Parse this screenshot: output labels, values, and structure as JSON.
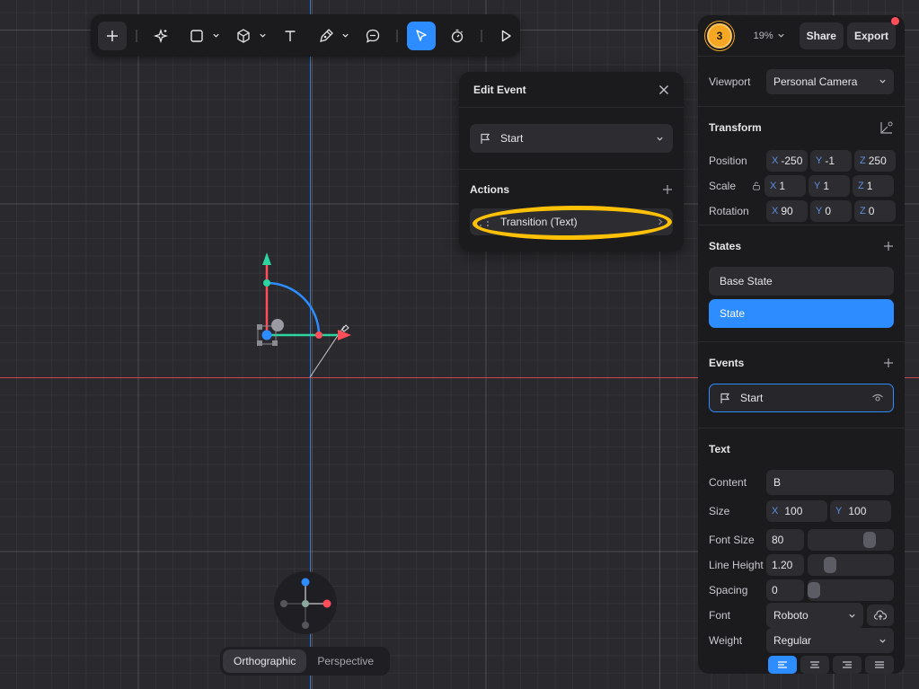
{
  "toolbar": {
    "tools": [
      "add-icon",
      "ai-sparkle-icon",
      "rectangle-icon",
      "cube-icon",
      "text-icon",
      "pen-icon",
      "comment-icon",
      "select-cursor-icon",
      "timer-icon",
      "play-icon"
    ]
  },
  "viewport": {
    "projection": {
      "orthographic": "Orthographic",
      "perspective": "Perspective",
      "active": "Orthographic"
    }
  },
  "edit_event": {
    "title": "Edit Event",
    "event_select": "Start",
    "actions_title": "Actions",
    "action_item": "Transition (Text)"
  },
  "panel": {
    "avatar_initial": "3",
    "zoom": "19%",
    "share": "Share",
    "export": "Export",
    "viewport_label": "Viewport",
    "viewport_value": "Personal Camera",
    "transform": {
      "title": "Transform",
      "position_label": "Position",
      "scale_label": "Scale",
      "rotation_label": "Rotation",
      "position": {
        "x": "-250",
        "y": "-1",
        "z": "250"
      },
      "scale": {
        "x": "1",
        "y": "1",
        "z": "1"
      },
      "rotation": {
        "x": "90",
        "y": "0",
        "z": "0"
      }
    },
    "states": {
      "title": "States",
      "items": [
        "Base State",
        "State"
      ],
      "active": "State"
    },
    "events": {
      "title": "Events",
      "item": "Start"
    },
    "text": {
      "title": "Text",
      "content_label": "Content",
      "content": "B",
      "size_label": "Size",
      "size_x": "100",
      "size_y": "100",
      "font_size_label": "Font Size",
      "font_size": "80",
      "line_height_label": "Line Height",
      "line_height": "1.20",
      "spacing_label": "Spacing",
      "spacing": "0",
      "font_label": "Font",
      "font": "Roboto",
      "weight_label": "Weight",
      "weight": "Regular"
    }
  },
  "axis_labels": {
    "x": "X",
    "y": "Y",
    "z": "Z"
  },
  "colors": {
    "accent": "#2d8cff",
    "highlight": "#ffc107",
    "x_axis": "#ff4d5a",
    "y_axis": "#2dd4a0",
    "avatar": "#f5a623"
  }
}
